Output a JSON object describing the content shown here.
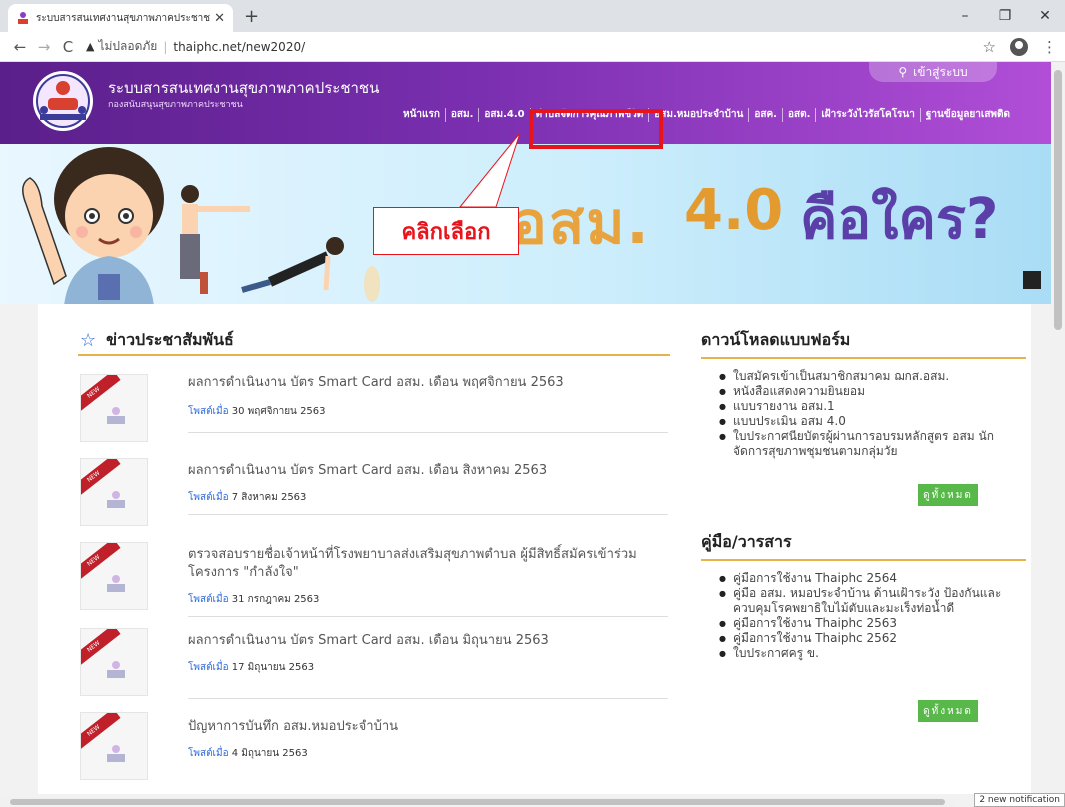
{
  "browser": {
    "tab_title": "ระบบสารสนเทศงานสุขภาพภาคประชาชน",
    "tab_close": "✕",
    "new_tab": "+",
    "win_min": "–",
    "win_max": "❐",
    "win_close": "✕",
    "back": "←",
    "forward": "→",
    "reload": "C",
    "insecure_label": "ไม่ปลอดภัย",
    "separator": "|",
    "url": "thaiphc.net/new2020/",
    "star": "☆",
    "menu": "⋮",
    "notification": "2 new notification"
  },
  "header": {
    "title": "ระบบสารสนเทศงานสุขภาพภาคประชาชน",
    "subtitle": "กองสนับสนุนสุขภาพภาคประชาชน",
    "login_label": "เข้าสู่ระบบ",
    "login_icon": "🔍",
    "nav": [
      {
        "label": "หน้าแรก"
      },
      {
        "label": "อสม."
      },
      {
        "label": "อสม.4.0"
      },
      {
        "label": "ตำบลจัดการคุณภาพชีวิต"
      },
      {
        "label": "อสม.หมอประจำบ้าน"
      },
      {
        "label": "อสค."
      },
      {
        "label": "อสต."
      },
      {
        "label": "เฝ้าระวังไวรัสโคโรนา"
      },
      {
        "label": "ฐานข้อมูลยาเสพติด"
      }
    ]
  },
  "banner": {
    "part1": "อสม.",
    "part2": "4.0",
    "part3": "คือใคร?"
  },
  "callout": {
    "text": "คลิกเลือก"
  },
  "news": {
    "heading": "ข่าวประชาสัมพันธ์",
    "star_icon": "☆",
    "ribbon": "NEW",
    "posted_label": "โพสต์เมื่อ",
    "items": [
      {
        "title": "ผลการดำเนินงาน บัตร Smart Card อสม. เดือน พฤศจิกายน 2563",
        "date": "30 พฤศจิกายน 2563"
      },
      {
        "title": "ผลการดำเนินงาน บัตร Smart Card อสม. เดือน สิงหาคม 2563",
        "date": "7 สิงหาคม 2563"
      },
      {
        "title": "ตรวจสอบรายชื่อเจ้าหน้าที่โรงพยาบาลส่งเสริมสุขภาพตำบล ผู้มีสิทธิ์สมัครเข้าร่วมโครงการ \"กำลังใจ\"",
        "date": "31 กรกฎาคม 2563"
      },
      {
        "title": "ผลการดำเนินงาน บัตร Smart Card อสม. เดือน มิถุนายน 2563",
        "date": "17 มิถุนายน 2563"
      },
      {
        "title": "ปัญหาการบันทึก อสม.หมอประจำบ้าน",
        "date": "4 มิถุนายน 2563"
      }
    ]
  },
  "downloads": {
    "heading": "ดาวน์โหลดแบบฟอร์ม",
    "items": [
      "ใบสมัครเข้าเป็นสมาชิกสมาคม ฌกส.อสม.",
      "หนังสือแสดงความยินยอม",
      "แบบรายงาน อสม.1",
      "แบบประเมิน อสม 4.0",
      "ใบประกาศนียบัตรผู้ผ่านการอบรมหลักสูตร อสม นักจัดการสุขภาพชุมชนตามกลุ่มวัย"
    ],
    "button": "ดูทั้งหมด"
  },
  "manuals": {
    "heading": "คู่มือ/วารสาร",
    "items": [
      "คู่มือการใช้งาน Thaiphc 2564",
      "คู่มือ อสม. หมอประจำบ้าน ด้านเฝ้าระวัง ป้องกันและควบคุมโรคพยาธิใบไม้ตับและมะเร็งท่อน้ำดี",
      "คู่มือการใช้งาน Thaiphc 2563",
      "คู่มือการใช้งาน Thaiphc 2562",
      "ใบประกาศครู ข."
    ],
    "button": "ดูทั้งหมด"
  },
  "colors": {
    "header_purple": "#7a2fb0",
    "highlight_red": "#e8141b",
    "accent_gold": "#e4b44a",
    "link_blue": "#2f6ad8",
    "button_green": "#59b84a"
  }
}
